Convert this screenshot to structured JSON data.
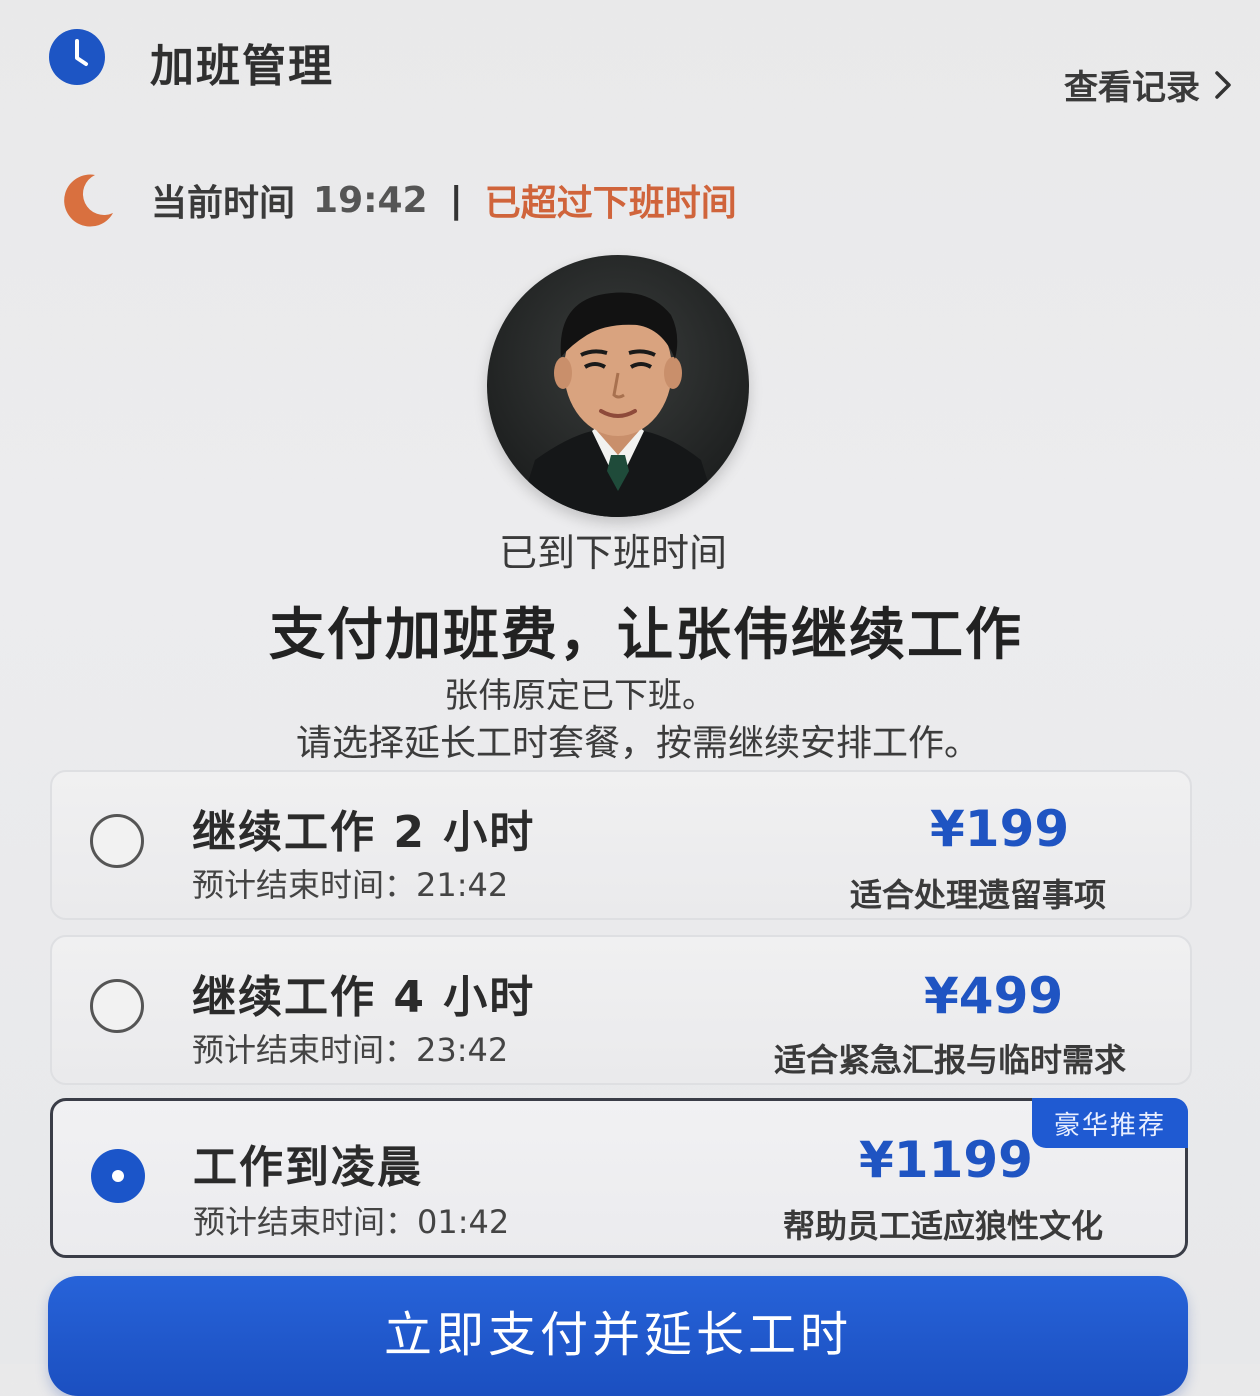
{
  "header": {
    "title": "加班管理",
    "history_label": "查看记录"
  },
  "status": {
    "time_label": "当前时间",
    "time_value": "19:42",
    "separator": "|",
    "warning": "已超过下班时间"
  },
  "profile": {
    "sub_status": "已到下班时间",
    "heading": "支付加班费，让张伟继续工作",
    "desc_line1": "张伟原定已下班。",
    "desc_line2": "请选择延长工时套餐，按需继续安排工作。"
  },
  "plans": [
    {
      "title": "继续工作 2 小时",
      "sub": "预计结束时间：21:42",
      "price": "¥199",
      "note": "适合处理遗留事项",
      "selected": false
    },
    {
      "title": "继续工作 4 小时",
      "sub": "预计结束时间：23:42",
      "price": "¥499",
      "note": "适合紧急汇报与临时需求",
      "selected": false
    },
    {
      "title": "工作到凌晨",
      "sub": "预计结束时间：01:42",
      "price": "¥1199",
      "note": "帮助员工适应狼性文化",
      "badge": "豪华推荐",
      "selected": true
    }
  ],
  "pay_button": "立即支付并延长工时",
  "colors": {
    "accent": "#1f54c2",
    "warning": "#d0643b",
    "moon": "#d9703f"
  },
  "icons": {
    "header": "clock-icon",
    "history": "chevron-right-icon",
    "status": "moon-icon"
  }
}
